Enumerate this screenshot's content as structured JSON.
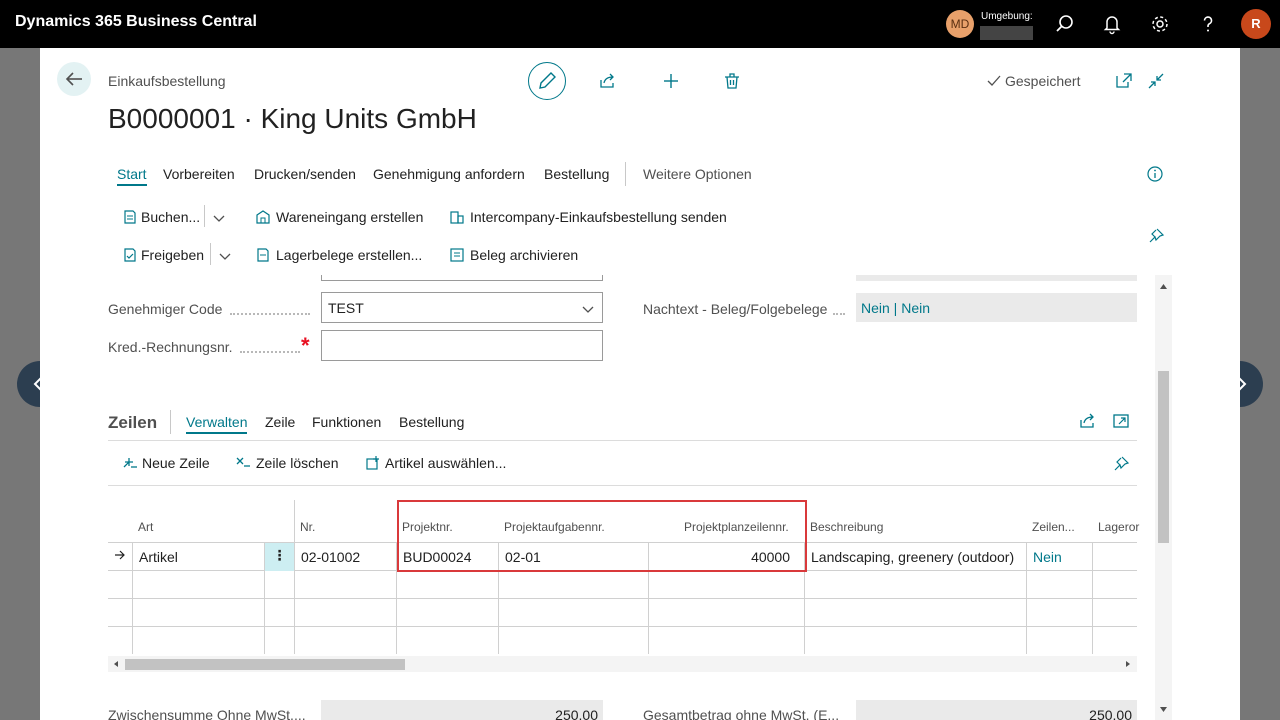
{
  "topbar": {
    "app_title": "Dynamics 365 Business Central",
    "user_initials": "MD",
    "environment_label": "Umgebung:",
    "account_initial": "R",
    "icons": [
      "search-icon",
      "bell-icon",
      "gear-icon",
      "help-icon"
    ]
  },
  "header": {
    "breadcrumb": "Einkaufsbestellung",
    "title": "B0000001 · King Units GmbH",
    "saved_label": "Gespeichert",
    "icons": [
      "back-icon",
      "edit-icon",
      "share-icon",
      "add-icon",
      "delete-icon",
      "open-new-window-icon",
      "collapse-icon"
    ]
  },
  "tabs": [
    {
      "label": "Start"
    },
    {
      "label": "Vorbereiten"
    },
    {
      "label": "Drucken/senden"
    },
    {
      "label": "Genehmigung anfordern"
    },
    {
      "label": "Bestellung"
    },
    {
      "label": "Weitere Optionen"
    }
  ],
  "actions": {
    "post": "Buchen...",
    "receipt": "Wareneingang erstellen",
    "intercompany": "Intercompany-Einkaufsbestellung senden",
    "release": "Freigeben",
    "warehouse_docs": "Lagerbelege erstellen...",
    "archive": "Beleg archivieren"
  },
  "form": {
    "approver_code_label": "Genehmiger Code",
    "approver_code_value": "TEST",
    "vendor_invoice_label": "Kred.-Rechnungsnr.",
    "vendor_invoice_value": "",
    "posttext_label": "Nachtext - Beleg/Folgebelege",
    "posttext_value": "Nein | Nein"
  },
  "lines": {
    "title": "Zeilen",
    "tabs": [
      "Verwalten",
      "Zeile",
      "Funktionen",
      "Bestellung"
    ],
    "actions": {
      "new_line": "Neue Zeile",
      "delete_line": "Zeile löschen",
      "select_items": "Artikel auswählen..."
    },
    "columns": [
      "Art",
      "Nr.",
      "Projektnr.",
      "Projektaufgabennr.",
      "Projektplanzeilennr.",
      "Beschreibung",
      "Zeilen...",
      "Lageror"
    ],
    "rows": [
      {
        "type": "Artikel",
        "no": "02-01002",
        "job_no": "BUD00024",
        "job_task_no": "02-01",
        "job_planning_line_no": "40000",
        "description": "Landscaping, greenery (outdoor)",
        "line_flag": "Nein"
      }
    ]
  },
  "totals": {
    "subtotal_label": "Zwischensumme Ohne MwSt....",
    "subtotal_value": "250.00",
    "total_label": "Gesamtbetrag ohne MwSt. (E...",
    "total_value": "250.00"
  },
  "colors": {
    "accent": "#00788a",
    "highlight": "#d9393b",
    "topbar": "#000000"
  }
}
